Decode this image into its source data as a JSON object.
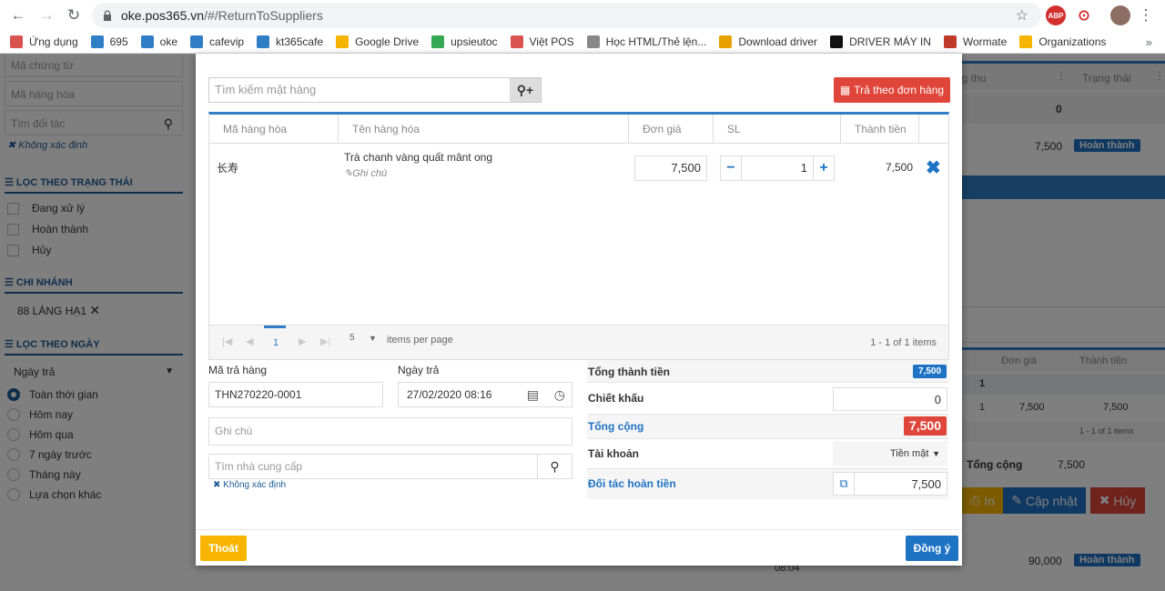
{
  "browser": {
    "url_host": "oke.pos365.vn",
    "url_path": "/#/ReturnToSuppliers",
    "bookmarks": [
      {
        "label": "Ứng dụng",
        "color": "#d9534f"
      },
      {
        "label": "695",
        "color": "#2f7ec6"
      },
      {
        "label": "oke",
        "color": "#2f7ec6"
      },
      {
        "label": "cafevip",
        "color": "#2f7ec6"
      },
      {
        "label": "kt365cafe",
        "color": "#2f7ec6"
      },
      {
        "label": "Google Drive",
        "color": "#f4b400"
      },
      {
        "label": "upsieutoc",
        "color": "#34a853"
      },
      {
        "label": "Việt POS",
        "color": "#d9534f"
      },
      {
        "label": "Học HTML/Thẻ lện...",
        "color": "#888888"
      },
      {
        "label": "Download driver",
        "color": "#e6a100"
      },
      {
        "label": "DRIVER MÁY IN",
        "color": "#111111"
      },
      {
        "label": "Wormate",
        "color": "#c0392b"
      },
      {
        "label": "Organizations",
        "color": "#f4b400"
      }
    ]
  },
  "sidebar": {
    "inputs": [
      "Mã chứng từ",
      "Mã hàng hóa",
      "Tìm đối tác"
    ],
    "unknown_partner": "Không xác định",
    "status_title": "LỌC THEO TRẠNG THÁI",
    "statuses": [
      "Đang xử lý",
      "Hoàn thành",
      "Hủy"
    ],
    "branch_title": "CHI NHÁNH",
    "branch_value": "88 LÁNG HẠ1",
    "date_title": "LỌC THEO NGÀY",
    "date_select": "Ngày trả",
    "date_options": [
      "Toàn thời gian",
      "Hôm nay",
      "Hôm qua",
      "7 ngày trước",
      "Tháng này",
      "Lựa chọn khác"
    ]
  },
  "background": {
    "col_thu": "ng thu",
    "col_status": "Trạng thái",
    "val_zero": "0",
    "row1_amount": "7,500",
    "row1_status": "Hoàn thành",
    "sub_col_price": "Đơn giá",
    "sub_col_total": "Thành tiền",
    "sub_qty": "1",
    "sub_price": "7,500",
    "sub_total": "7,500",
    "sub_pager": "1 - 1 of 1 items",
    "sum_label": "Tổng cộng",
    "sum_value": "7,500",
    "btn_print": "In",
    "btn_update": "Cập nhật",
    "btn_cancel": "Hủy",
    "row2_amount": "90,000",
    "row2_status": "Hoàn thành",
    "row2_time": "08:04"
  },
  "modal": {
    "search_placeholder": "Tìm kiếm mặt hàng",
    "return_by_order": "Trả theo đơn hàng",
    "columns": [
      "Mã hàng hóa",
      "Tên hàng hóa",
      "Đơn giá",
      "SL",
      "Thành tiền"
    ],
    "item": {
      "code": "长寿",
      "name": "Trà chanh vàng quất mânt ong",
      "note": "Ghi chú",
      "price": "7,500",
      "qty": "1",
      "total": "7,500"
    },
    "pager": {
      "page": "1",
      "page_size": "5",
      "per_page_label": "items per page",
      "summary": "1 - 1 of 1 items"
    },
    "form": {
      "code_label": "Mã trả hàng",
      "code_value": "THN270220-0001",
      "date_label": "Ngày trả",
      "date_value": "27/02/2020 08:16",
      "note_placeholder": "Ghi chú",
      "supplier_placeholder": "Tìm nhà cung cấp",
      "supplier_unknown": "Không xác định"
    },
    "summary": {
      "subtotal_label": "Tổng thành tiền",
      "subtotal_value": "7,500",
      "discount_label": "Chiết khấu",
      "discount_value": "0",
      "total_label": "Tổng cộng",
      "total_value": "7,500",
      "account_label": "Tài khoản",
      "account_value": "Tiền mặt",
      "refund_label": "Đối tác hoàn tiền",
      "refund_value": "7,500"
    },
    "btn_exit": "Thoát",
    "btn_ok": "Đồng ý"
  },
  "colors": {
    "primary": "#1f73c4",
    "danger": "#e0453a",
    "warning": "#f7b500",
    "sidebar_heading": "#1f5c99"
  }
}
